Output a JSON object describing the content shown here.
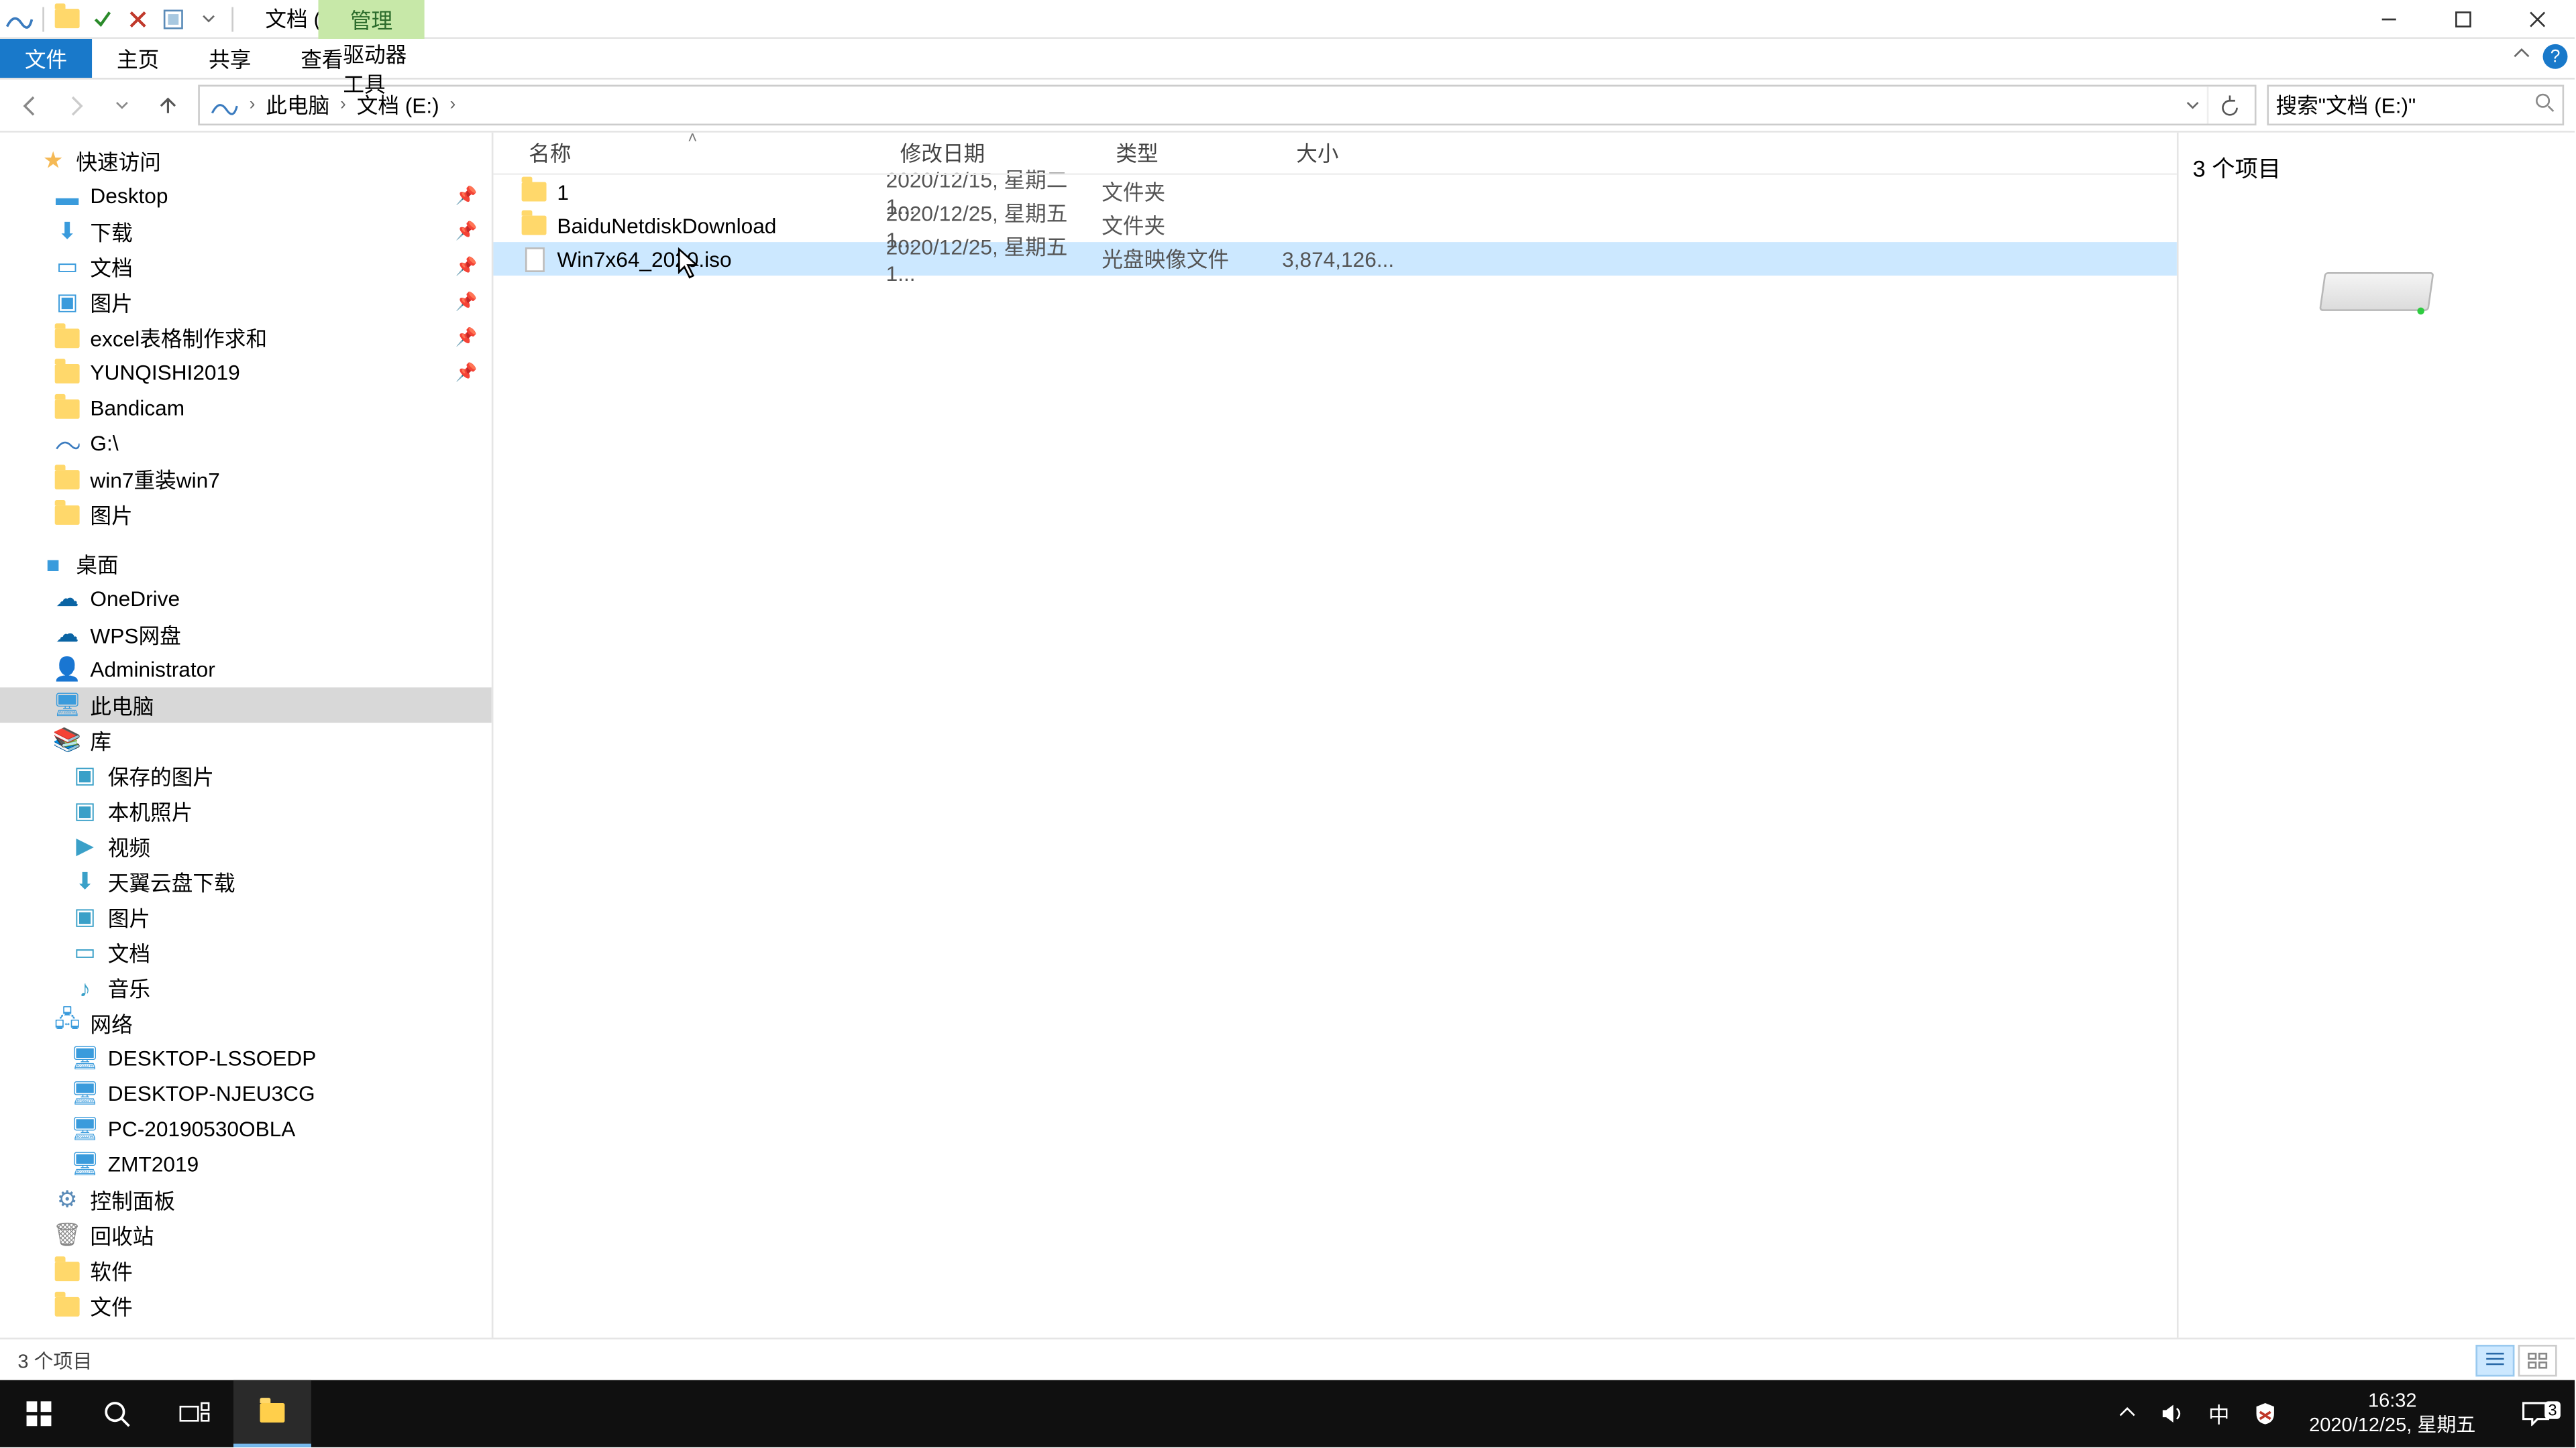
{
  "title": {
    "context_tab": "管理",
    "path_label": "文档 (E:)"
  },
  "ribbon": {
    "file": "文件",
    "home": "主页",
    "share": "共享",
    "view": "查看",
    "drive_tools": "驱动器工具"
  },
  "address": {
    "root": "此电脑",
    "location": "文档 (E:)",
    "search_placeholder": "搜索\"文档 (E:)\""
  },
  "nav": {
    "quick_access": "快速访问",
    "desktop_qa": "Desktop",
    "downloads": "下载",
    "documents": "文档",
    "pictures": "图片",
    "excel_help": "excel表格制作求和",
    "yunqishi": "YUNQISHI2019",
    "bandicam": "Bandicam",
    "g_drive": "G:\\",
    "win7_reinstall": "win7重装win7",
    "pictures2": "图片",
    "desktop_root": "桌面",
    "onedrive": "OneDrive",
    "wps": "WPS网盘",
    "admin": "Administrator",
    "this_pc": "此电脑",
    "libraries": "库",
    "saved_pictures": "保存的图片",
    "camera_roll": "本机照片",
    "videos": "视频",
    "tianyi": "天翼云盘下载",
    "pictures_lib": "图片",
    "documents_lib": "文档",
    "music": "音乐",
    "network": "网络",
    "pc1": "DESKTOP-LSSOEDP",
    "pc2": "DESKTOP-NJEU3CG",
    "pc3": "PC-20190530OBLA",
    "pc4": "ZMT2019",
    "control_panel": "控制面板",
    "recycle_bin": "回收站",
    "software": "软件",
    "files": "文件"
  },
  "columns": {
    "name": "名称",
    "date": "修改日期",
    "type": "类型",
    "size": "大小"
  },
  "files": {
    "f1": {
      "name": "1",
      "date": "2020/12/15, 星期二 1...",
      "type": "文件夹",
      "size": ""
    },
    "f2": {
      "name": "BaiduNetdiskDownload",
      "date": "2020/12/25, 星期五 1...",
      "type": "文件夹",
      "size": ""
    },
    "f3": {
      "name": "Win7x64_2020.iso",
      "date": "2020/12/25, 星期五 1...",
      "type": "光盘映像文件",
      "size": "3,874,126..."
    }
  },
  "details": {
    "count_label": "3 个项目"
  },
  "status": {
    "text": "3 个项目"
  },
  "clock": {
    "time": "16:32",
    "date": "2020/12/25, 星期五"
  },
  "notif_badge": "3",
  "ime": "中"
}
